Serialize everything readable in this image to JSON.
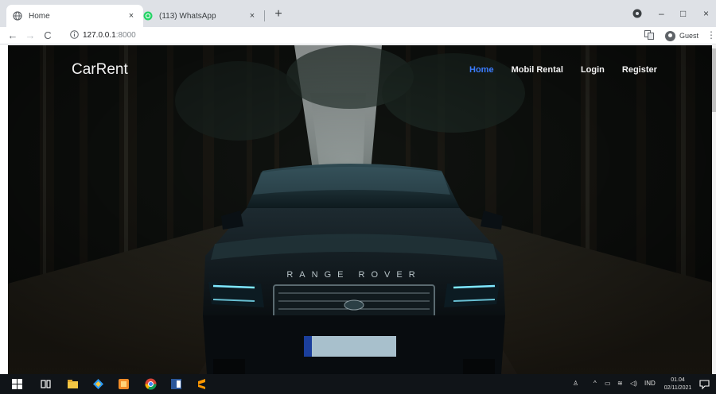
{
  "browser": {
    "tabs": [
      {
        "title": "Home",
        "active": true,
        "favicon": "globe-icon"
      },
      {
        "title": "(113) WhatsApp",
        "active": false,
        "favicon": "whatsapp-icon"
      }
    ],
    "new_tab_label": "+",
    "close_label": "×",
    "address": {
      "host": "127.0.0.1",
      "port": ":8000"
    },
    "profile_label": "Guest",
    "window_controls": {
      "minimize": "–",
      "maximize": "□",
      "close": "×"
    }
  },
  "site": {
    "brand": "CarRent",
    "nav": [
      {
        "label": "Home",
        "active": true
      },
      {
        "label": "Mobil Rental",
        "active": false
      },
      {
        "label": "Login",
        "active": false
      },
      {
        "label": "Register",
        "active": false
      }
    ],
    "hero": {
      "plate_text": "RANGE ROVER"
    }
  },
  "taskbar": {
    "language": "IND",
    "time": "01.04",
    "date": "02/11/2021"
  },
  "colors": {
    "nav_active": "#3b7cff",
    "nav_text": "#f2f2f2",
    "forest_dark": "#0d0f0d",
    "car_body": "#0b1014",
    "headlight": "#7fe8ff"
  }
}
